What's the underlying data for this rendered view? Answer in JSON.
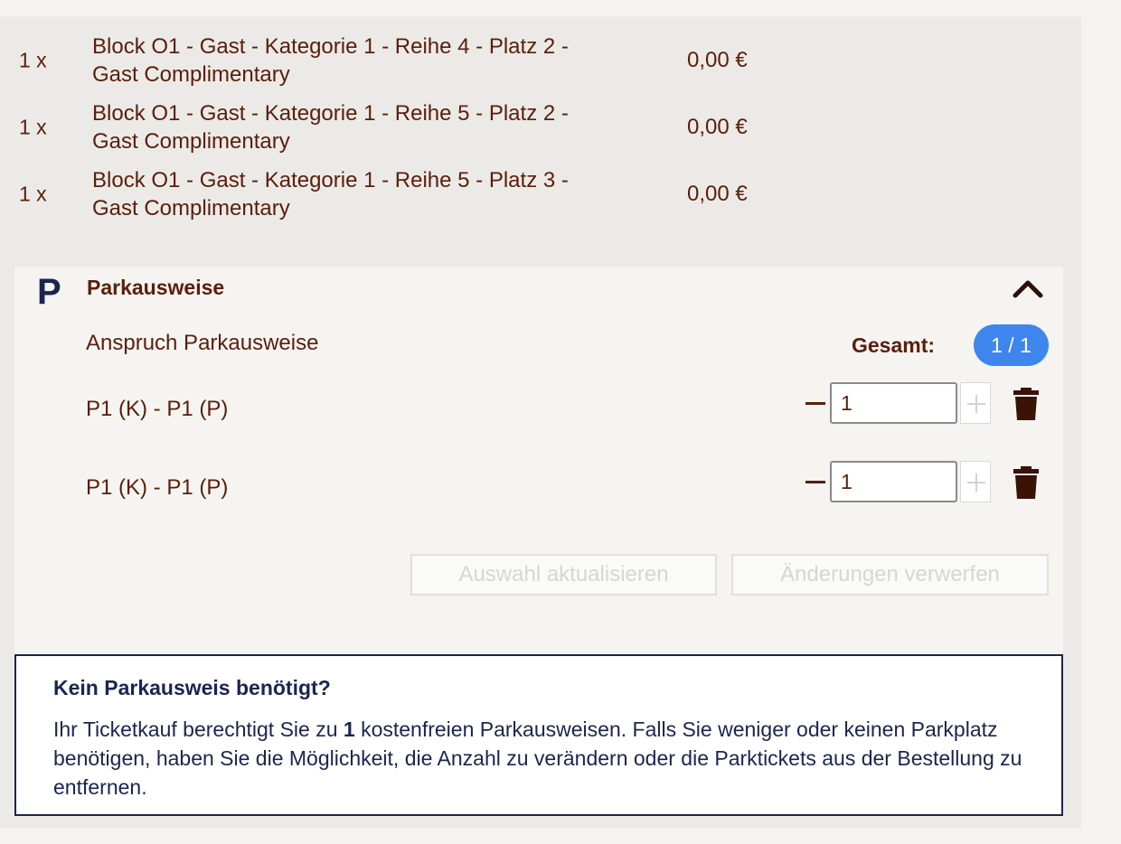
{
  "tickets": [
    {
      "qty": "1 x",
      "line1": "Block O1 - Gast - Kategorie 1 - Reihe 4 - Platz 2 -",
      "line2": "Gast Complimentary",
      "price": "0,00 €"
    },
    {
      "qty": "1 x",
      "line1": "Block O1 - Gast - Kategorie 1 - Reihe 5 - Platz 2 -",
      "line2": "Gast Complimentary",
      "price": "0,00 €"
    },
    {
      "qty": "1 x",
      "line1": "Block O1 - Gast - Kategorie 1 - Reihe 5 - Platz 3 -",
      "line2": "Gast Complimentary",
      "price": "0,00 €"
    }
  ],
  "parking": {
    "logo": "P",
    "title": "Parkausweise",
    "claim_label": "Anspruch Parkausweise",
    "total_label": "Gesamt:",
    "total_value": "1 / 1",
    "items": [
      {
        "label": "P1 (K) - P1 (P)",
        "quantity": "1"
      },
      {
        "label": "P1 (K) - P1 (P)",
        "quantity": "1"
      }
    ],
    "update_button": "Auswahl aktualisieren",
    "discard_button": "Änderungen verwerfen"
  },
  "info": {
    "title": "Kein Parkausweis benötigt?",
    "text_before": "Ihr Ticketkauf berechtigt Sie zu ",
    "count": "1",
    "text_after": " kostenfreien Parkausweisen. Falls Sie weniger oder keinen Parkplatz benötigen, haben Sie die Möglichkeit, die Anzahl zu verändern oder die Parktickets aus der Bestellung zu entfernen."
  },
  "colors": {
    "text_brown": "#5a1e0c",
    "navy": "#1b2550",
    "badge_blue": "#3e86ee"
  }
}
